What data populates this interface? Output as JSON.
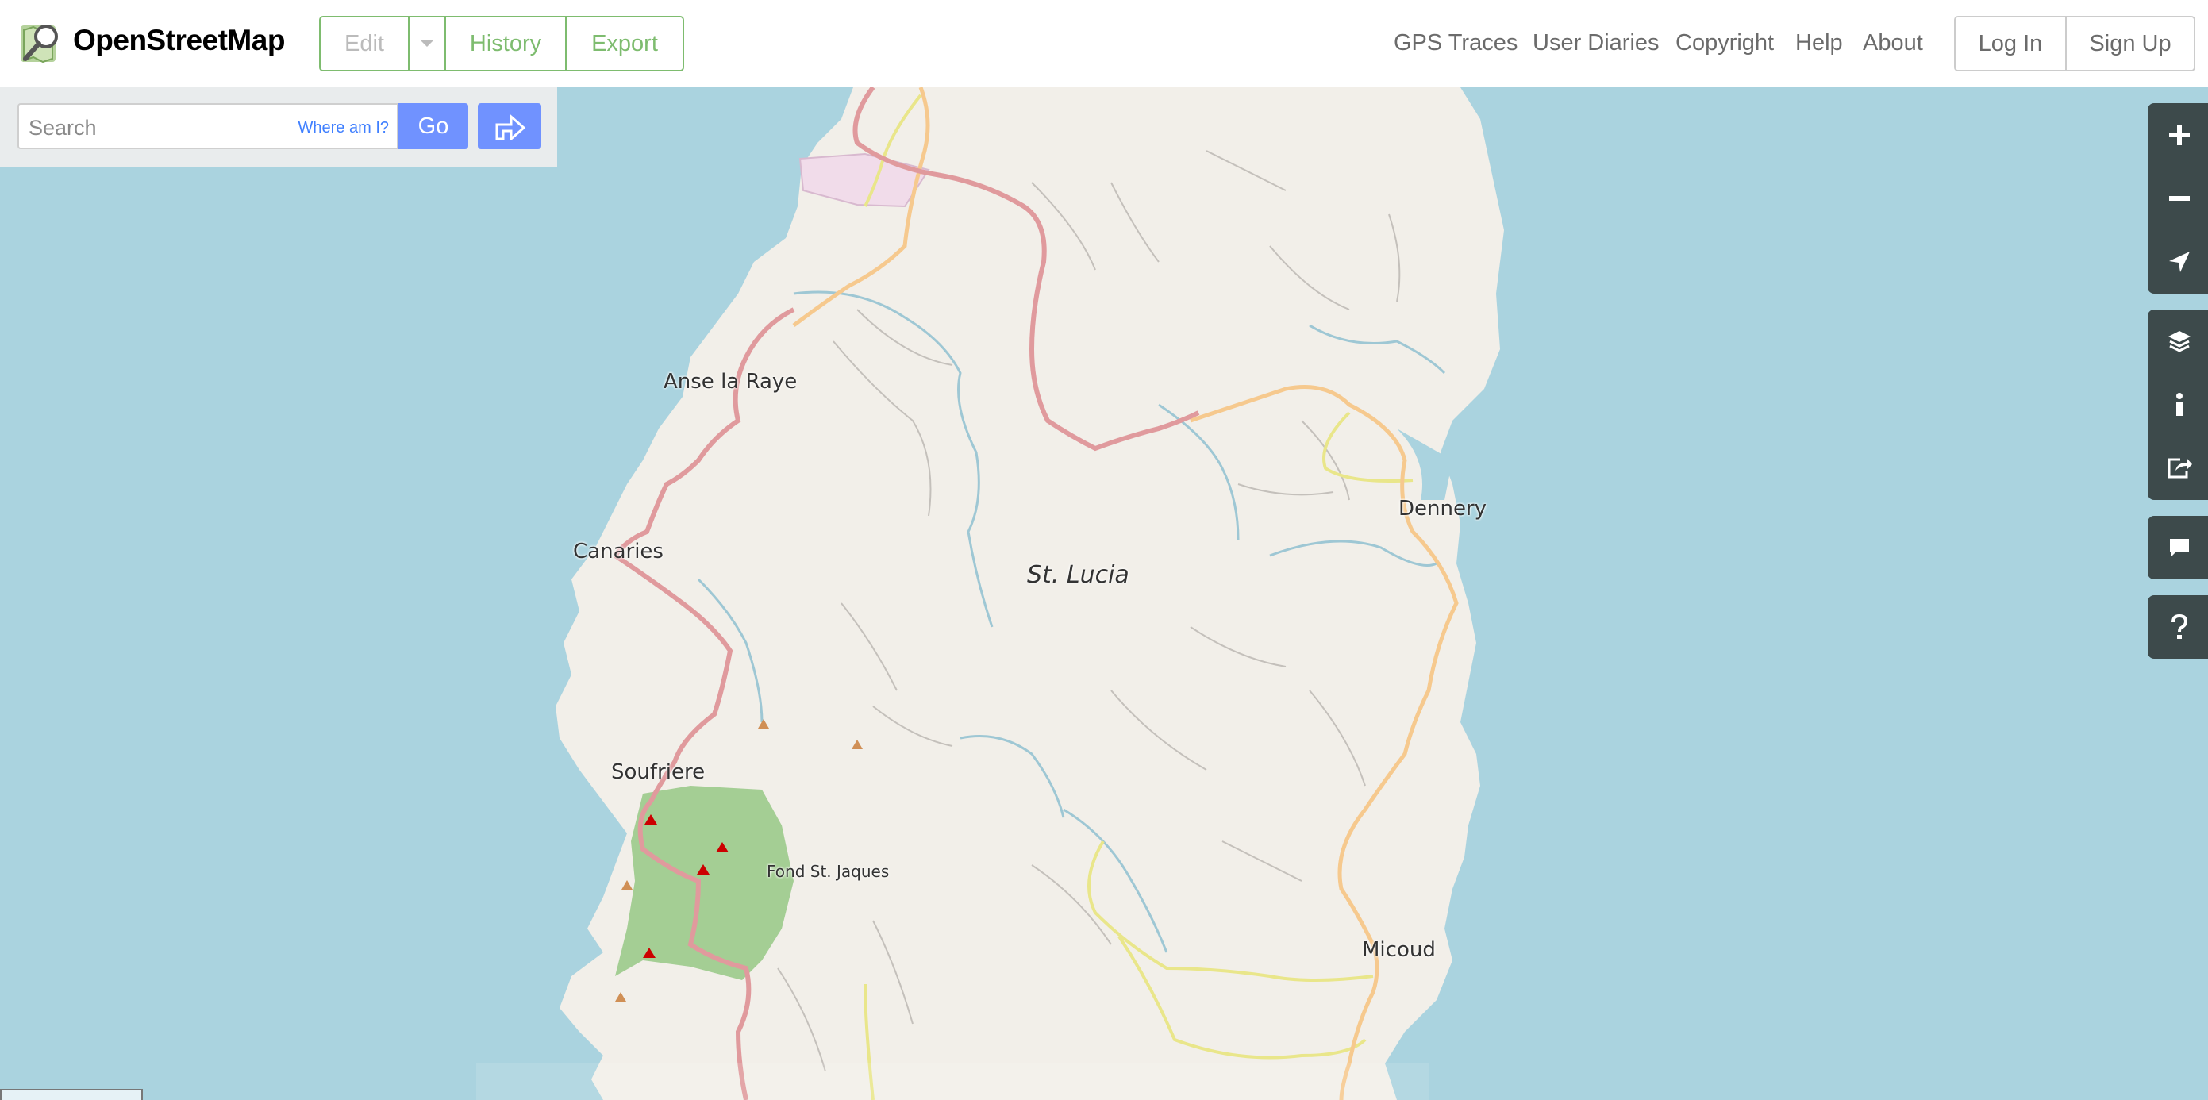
{
  "header": {
    "brand": "OpenStreetMap",
    "edit_label": "Edit",
    "history_label": "History",
    "export_label": "Export",
    "nav": {
      "gps_traces": "GPS Traces",
      "user_diaries": "User Diaries",
      "copyright": "Copyright",
      "help": "Help",
      "about": "About"
    },
    "login_label": "Log In",
    "signup_label": "Sign Up"
  },
  "search": {
    "placeholder": "Search",
    "where_am_i": "Where am I?",
    "go_label": "Go"
  },
  "map": {
    "island_label": "St. Lucia",
    "places": {
      "anse_la_raye": "Anse la Raye",
      "canaries": "Canaries",
      "dennery": "Dennery",
      "soufriere": "Soufriere",
      "fond_st_jaques": "Fond St. Jaques",
      "micoud": "Micoud"
    },
    "colors": {
      "water": "#aad3df",
      "land": "#f2efe9",
      "forest": "#9fcb8f",
      "primary_road": "#e09a9d",
      "secondary_road": "#f6c98e",
      "tertiary_road": "#f3f0a3",
      "stream": "#9ec7d4",
      "industrial": "#f1dcea",
      "accent": "#7ebc6f",
      "button": "#7092ff"
    }
  },
  "controls": {
    "zoom_in": "zoom-in-icon",
    "zoom_out": "zoom-out-icon",
    "locate": "locate-icon",
    "layers": "layers-icon",
    "info": "info-icon",
    "share": "share-icon",
    "note": "note-icon",
    "help": "help-icon"
  }
}
